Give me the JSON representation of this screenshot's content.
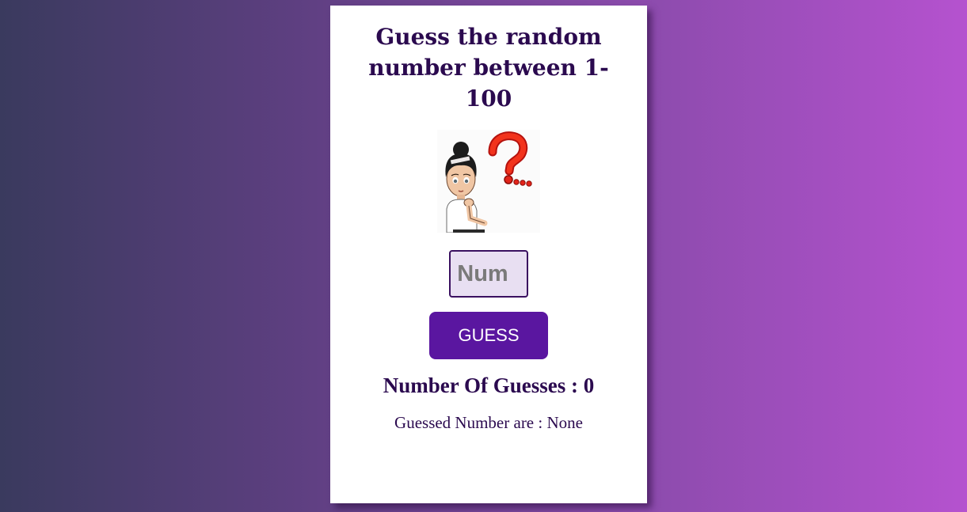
{
  "colors": {
    "background_start": "#3a3a5e",
    "background_end": "#b552cf",
    "heading": "#2b0a4f",
    "button": "#5a16a0",
    "input_bg": "#e8dff2"
  },
  "game": {
    "title": "Guess the random number between 1-100",
    "illustration_icon": "thinking-girl-question-mark",
    "input_placeholder": "Num",
    "guess_label": "GUESS",
    "count_label": "Number Of Guesses : 0",
    "guessed_label": "Guessed Number are : None"
  }
}
